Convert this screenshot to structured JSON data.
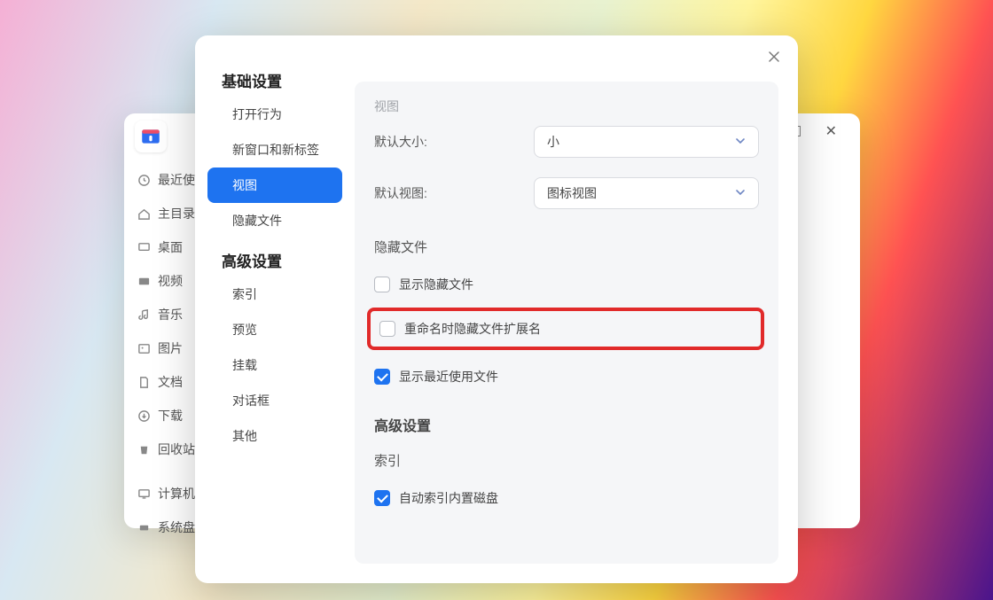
{
  "bg_window": {
    "title_controls": {
      "minimize": "—",
      "maximize": "▢",
      "close": "✕"
    },
    "sidebar_items": [
      {
        "icon": "clock",
        "label": "最近使"
      },
      {
        "icon": "home",
        "label": "主目录"
      },
      {
        "icon": "desktop",
        "label": "桌面"
      },
      {
        "icon": "video",
        "label": "视频"
      },
      {
        "icon": "music",
        "label": "音乐"
      },
      {
        "icon": "picture",
        "label": "图片"
      },
      {
        "icon": "doc",
        "label": "文档"
      },
      {
        "icon": "download",
        "label": "下载"
      },
      {
        "icon": "trash",
        "label": "回收站"
      },
      {
        "icon": "computer",
        "label": "计算机"
      },
      {
        "icon": "disk",
        "label": "系统盘"
      }
    ]
  },
  "dialog": {
    "nav": {
      "basic_title": "基础设置",
      "advanced_title": "高级设置",
      "basic_items": [
        {
          "label": "打开行为"
        },
        {
          "label": "新窗口和新标签"
        },
        {
          "label": "视图",
          "active": true
        },
        {
          "label": "隐藏文件"
        }
      ],
      "advanced_items": [
        {
          "label": "索引"
        },
        {
          "label": "预览"
        },
        {
          "label": "挂载"
        },
        {
          "label": "对话框"
        },
        {
          "label": "其他"
        }
      ]
    },
    "panel": {
      "scrolled_hint": "视图",
      "default_size_label": "默认大小:",
      "default_size_value": "小",
      "default_view_label": "默认视图:",
      "default_view_value": "图标视图",
      "hidden_section_title": "隐藏文件",
      "cb_show_hidden": "显示隐藏文件",
      "cb_hide_ext_on_rename": "重命名时隐藏文件扩展名",
      "cb_show_recent": "显示最近使用文件",
      "advanced_section_title": "高级设置",
      "index_section_title": "索引",
      "cb_auto_index": "自动索引内置磁盘"
    }
  }
}
